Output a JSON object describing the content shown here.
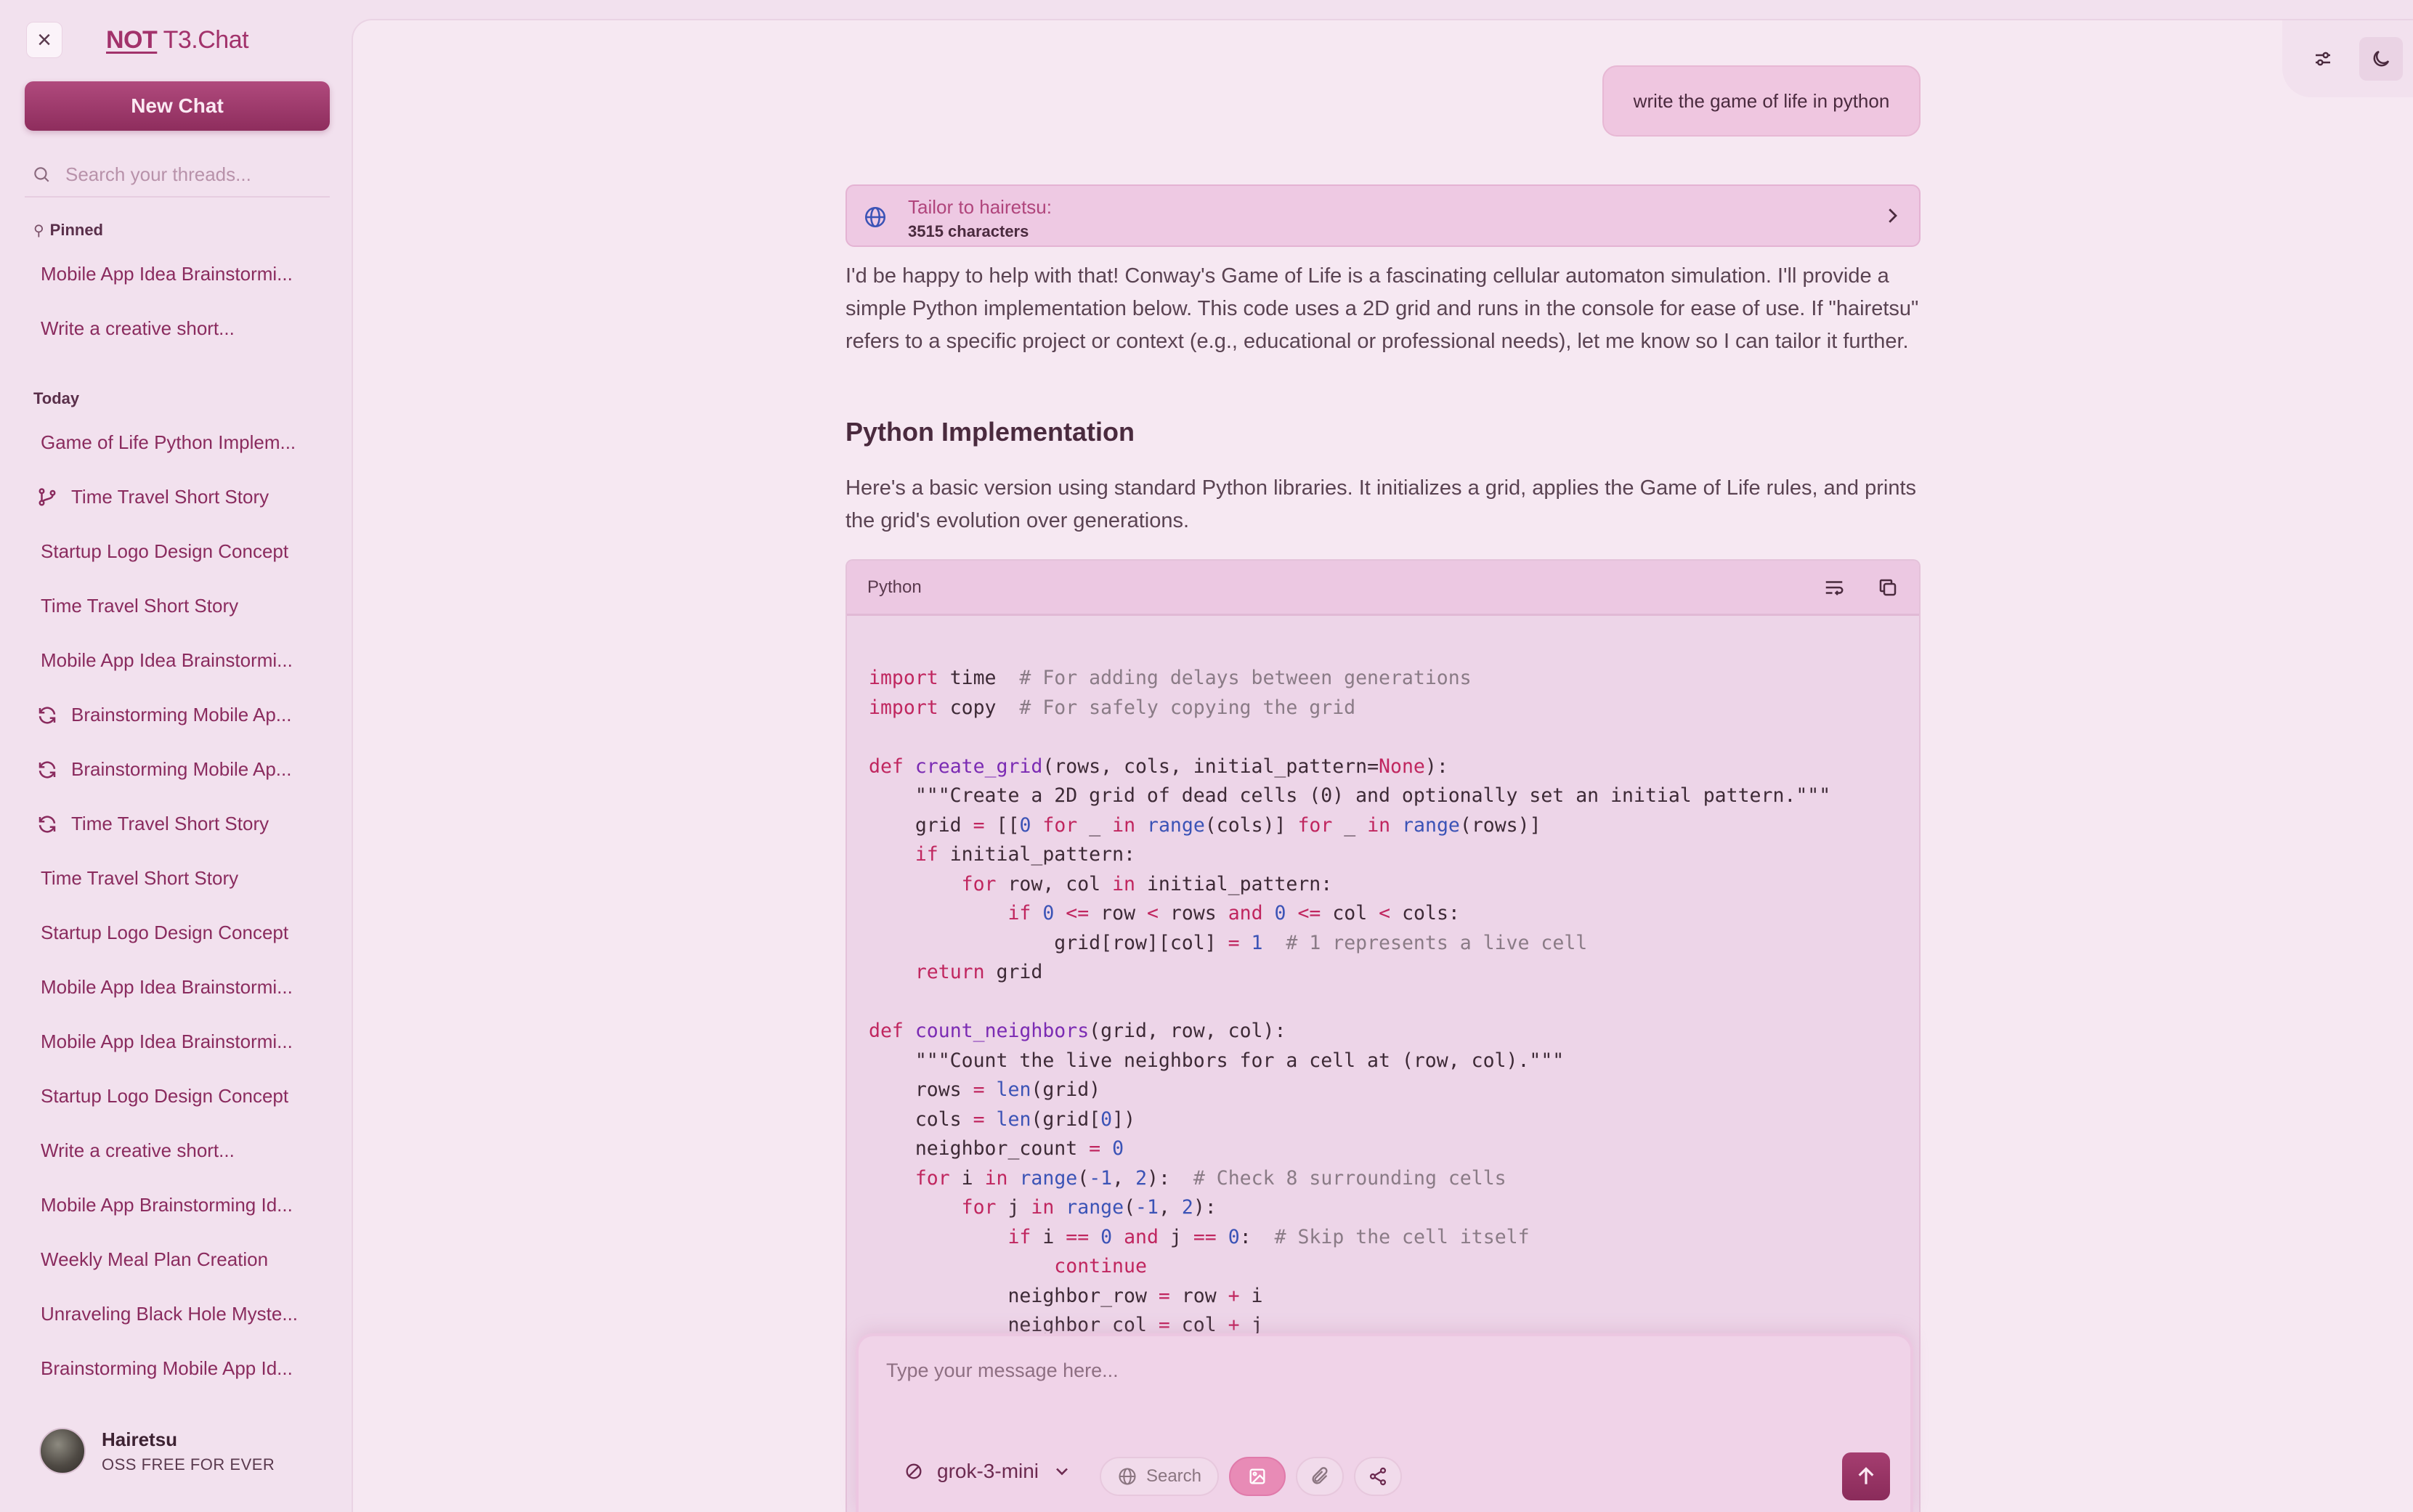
{
  "sidebar": {
    "brand_prefix": "NOT",
    "brand_rest": " T3.Chat",
    "new_chat_label": "New Chat",
    "search_placeholder": "Search your threads...",
    "pinned_label": "Pinned",
    "pinned": [
      {
        "label": "Mobile App Idea Brainstormi..."
      },
      {
        "label": "Write a creative short..."
      }
    ],
    "today_label": "Today",
    "today": [
      {
        "label": "Game of Life Python Implem...",
        "icon": ""
      },
      {
        "label": "Time Travel Short Story",
        "icon": "branch-icon"
      },
      {
        "label": "Startup Logo Design Concept",
        "icon": ""
      },
      {
        "label": "Time Travel Short Story",
        "icon": ""
      },
      {
        "label": "Mobile App Idea Brainstormi...",
        "icon": ""
      },
      {
        "label": "Brainstorming Mobile Ap...",
        "icon": "refresh-icon"
      },
      {
        "label": "Brainstorming Mobile Ap...",
        "icon": "refresh-icon"
      },
      {
        "label": "Time Travel Short Story",
        "icon": "refresh-icon"
      },
      {
        "label": "Time Travel Short Story",
        "icon": ""
      },
      {
        "label": "Startup Logo Design Concept",
        "icon": ""
      },
      {
        "label": "Mobile App Idea Brainstormi...",
        "icon": ""
      },
      {
        "label": "Mobile App Idea Brainstormi...",
        "icon": ""
      },
      {
        "label": "Startup Logo Design Concept",
        "icon": ""
      },
      {
        "label": "Write a creative short...",
        "icon": ""
      },
      {
        "label": "Mobile App Brainstorming Id...",
        "icon": ""
      },
      {
        "label": "Weekly Meal Plan Creation",
        "icon": ""
      },
      {
        "label": "Unraveling Black Hole Myste...",
        "icon": ""
      },
      {
        "label": "Brainstorming Mobile App Id...",
        "icon": ""
      }
    ],
    "user": {
      "name": "Hairetsu",
      "subtitle": "OSS FREE FOR EVER"
    }
  },
  "chat": {
    "user_message": "write the game of life in python",
    "tailor_title": "Tailor to hairetsu:",
    "tailor_sub": "3515 characters",
    "intro": "I'd be happy to help with that! Conway's Game of Life is a fascinating cellular automaton simulation. I'll provide a simple Python implementation below. This code uses a 2D grid and runs in the console for ease of use. If \"hairetsu\" refers to a specific project or context (e.g., educational or professional needs), let me know so I can tailor it further.",
    "heading": "Python Implementation",
    "para2": "Here's a basic version using standard Python libraries. It initializes a grid, applies the Game of Life rules, and prints the grid's evolution over generations.",
    "code_lang": "Python",
    "code_lines": [
      "import time  # For adding delays between generations",
      "import copy  # For safely copying the grid",
      "",
      "def create_grid(rows, cols, initial_pattern=None):",
      "    \"\"\"Create a 2D grid of dead cells (0) and optionally set an initial pattern.\"\"\"",
      "    grid = [[0 for _ in range(cols)] for _ in range(rows)]",
      "    if initial_pattern:",
      "        for row, col in initial_pattern:",
      "            if 0 <= row < rows and 0 <= col < cols:",
      "                grid[row][col] = 1  # 1 represents a live cell",
      "    return grid",
      "",
      "def count_neighbors(grid, row, col):",
      "    \"\"\"Count the live neighbors for a cell at (row, col).\"\"\"",
      "    rows = len(grid)",
      "    cols = len(grid[0])",
      "    neighbor_count = 0",
      "    for i in range(-1, 2):  # Check 8 surrounding cells",
      "        for j in range(-1, 2):",
      "            if i == 0 and j == 0:  # Skip the cell itself",
      "                continue",
      "            neighbor_row = row + i",
      "            neighbor_col = col + j"
    ]
  },
  "composer": {
    "placeholder": "Type your message here...",
    "model": "grok-3-mini",
    "search_label": "Search"
  },
  "colors": {
    "accent": "#a2326b",
    "background": "#f2e1ee",
    "panel": "#f6e8f2",
    "code_bg": "#edd5e8"
  }
}
